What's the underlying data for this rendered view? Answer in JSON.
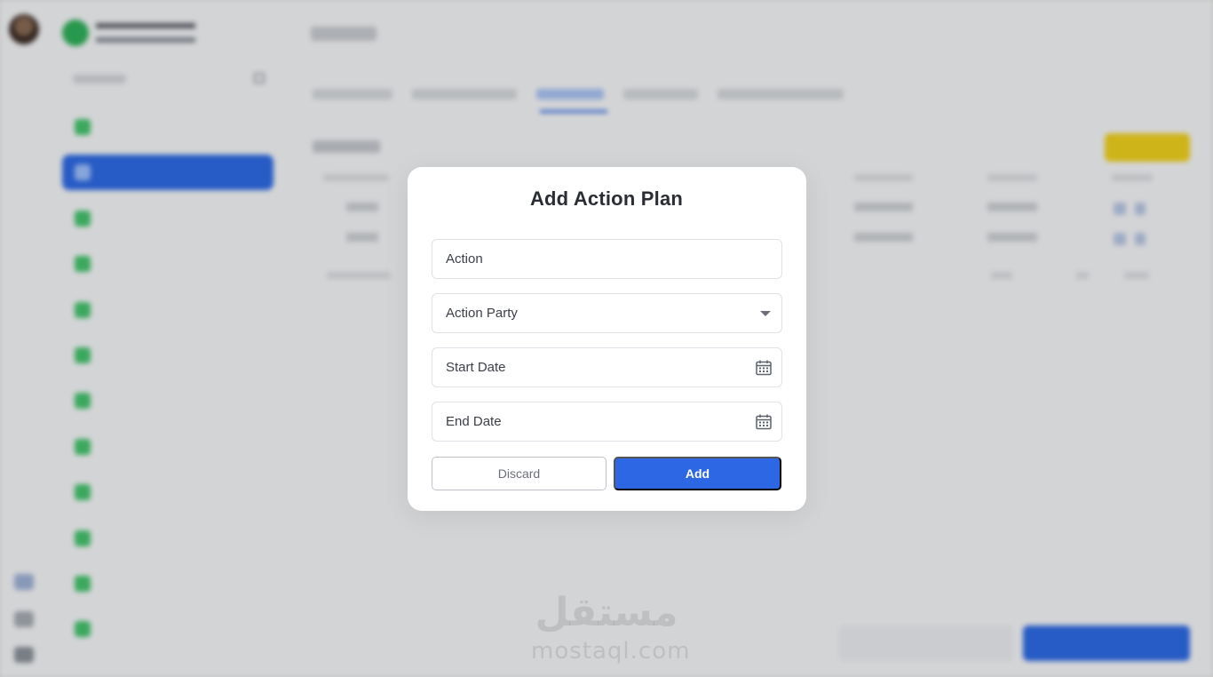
{
  "modal": {
    "title": "Add Action Plan",
    "fields": [
      {
        "placeholder": "Action",
        "type": "text"
      },
      {
        "placeholder": "Action Party",
        "type": "select"
      },
      {
        "placeholder": "Start Date",
        "type": "date"
      },
      {
        "placeholder": "End Date",
        "type": "date"
      }
    ],
    "discard_label": "Discard",
    "add_label": "Add"
  },
  "watermark": {
    "arabic": "مستقل",
    "latin": "mostaql.com"
  },
  "colors": {
    "primary": "#2d67e3",
    "accent_yellow": "#f2d21e",
    "sidebar_icon_green": "#45c46e"
  },
  "icons": {
    "select": "chevron-down-icon",
    "date": "calendar-icon"
  }
}
